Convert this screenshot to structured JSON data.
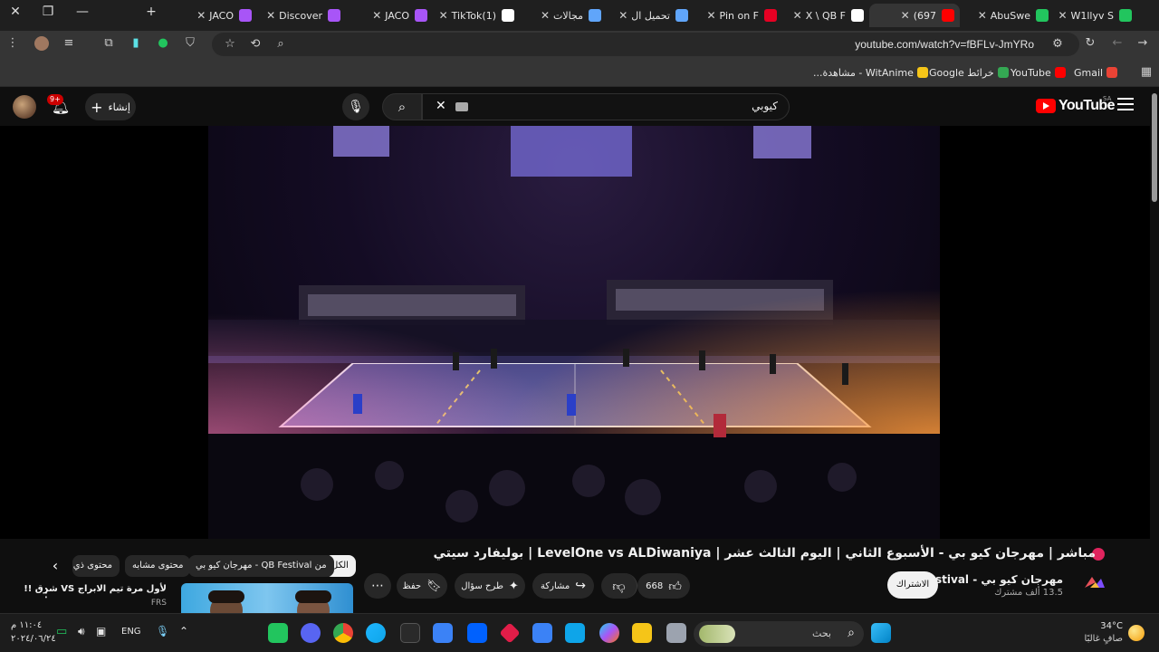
{
  "browser": {
    "tabs": [
      {
        "label": "AbuSwe",
        "fav_color": "#22c55e"
      },
      {
        "label": "W1llyv S",
        "fav_color": "#22c55e"
      },
      {
        "label": "697)",
        "fav_color": "#ff0000",
        "active": true
      },
      {
        "label": "X \\ QB F",
        "fav_color": "#ffffff"
      },
      {
        "label": "Pin on F",
        "fav_color": "#e60023"
      },
      {
        "label": "تحميل ال",
        "fav_color": "#60a5fa"
      },
      {
        "label": "مجالات",
        "fav_color": "#60a5fa"
      },
      {
        "label": "(1)TikTok",
        "fav_color": "#ffffff"
      },
      {
        "label": "JACO",
        "fav_color": "#a855f7"
      },
      {
        "label": "Discover",
        "fav_color": "#a855f7"
      },
      {
        "label": "JACO",
        "fav_color": "#a855f7"
      }
    ],
    "url": "youtube.com/watch?v=fBFLv-JmYRo",
    "bookmarks": [
      {
        "label": "Gmail",
        "color": "#ea4335"
      },
      {
        "label": "YouTube",
        "color": "#ff0000"
      },
      {
        "label": "خرائط Google",
        "color": "#34a853"
      },
      {
        "label": "WitAnime - مشاهدة...",
        "color": "#f5c518"
      }
    ]
  },
  "youtube": {
    "logo_text": "YouTube",
    "region": "SA",
    "search_query": "كيوبي",
    "create_label": "إنشاء",
    "notification_count": "9+",
    "video_title": "مباشر | مهرجان كيو بي - الأسبوع الثاني | اليوم الثالث عشر | LevelOne vs ALDiwaniya | بوليفارد سيتي",
    "channel_name": "مهرجان كيو بي - QB Festival",
    "channel_subs": "13.5 ألف مشترك",
    "subscribe_label": "الاشتراك",
    "like_count": "668",
    "share_label": "مشاركة",
    "ask_label": "طرح سؤال",
    "save_label": "حفظ",
    "chips": [
      "الكل",
      "من QB Festival - مهرجان كيو بي",
      "محتوى مشابه",
      "محتوى ذي"
    ],
    "recommended": {
      "title": "لأول مرة تيم الابراج VS شرق !!",
      "channel": "FRS"
    }
  },
  "taskbar": {
    "search_placeholder": "بحث",
    "weather_temp": "34°C",
    "weather_desc": "صافٍ غالبًا",
    "lang": "ENG",
    "time": "١١:٠٤ م",
    "date": "٢٠٢٤/٠٦/٢٤"
  }
}
